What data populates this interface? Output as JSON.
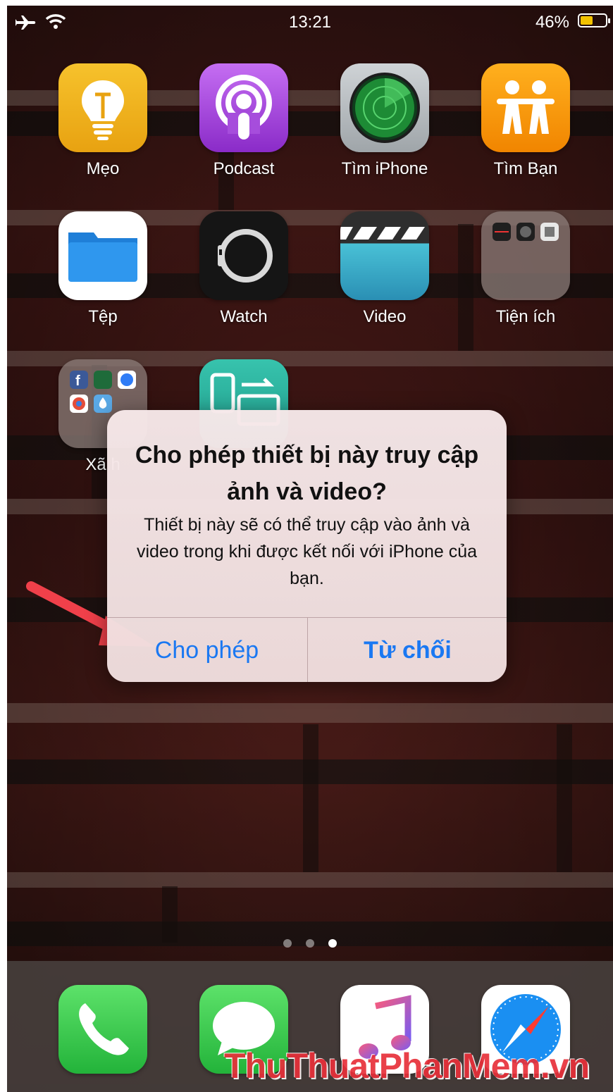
{
  "status_bar": {
    "time": "13:21",
    "battery_percent": "46%",
    "battery_level": 0.46,
    "battery_color": "#f2c200"
  },
  "home_screen": {
    "rows": [
      [
        {
          "label": "Mẹo",
          "icon": "lightbulb-icon"
        },
        {
          "label": "Podcast",
          "icon": "podcast-icon"
        },
        {
          "label": "Tìm iPhone",
          "icon": "find-iphone-radar-icon"
        },
        {
          "label": "Tìm Bạn",
          "icon": "find-friends-icon"
        }
      ],
      [
        {
          "label": "Tệp",
          "icon": "folder-icon"
        },
        {
          "label": "Watch",
          "icon": "watch-icon"
        },
        {
          "label": "Video",
          "icon": "clapperboard-icon"
        },
        {
          "label": "Tiện ích",
          "icon": "utilities-folder-icon"
        }
      ],
      [
        {
          "label": "Xã h",
          "icon": "social-folder-icon"
        },
        {
          "label": "",
          "icon": "device-transfer-icon"
        }
      ]
    ],
    "page_indicator": {
      "count": 3,
      "active_index": 2
    }
  },
  "dock": [
    {
      "icon": "phone-icon"
    },
    {
      "icon": "messages-icon"
    },
    {
      "icon": "music-icon"
    },
    {
      "icon": "safari-compass-icon"
    }
  ],
  "dialog": {
    "title": "Cho phép thiết bị này truy cập ảnh và video?",
    "message": "Thiết bị này sẽ có thể truy cập vào ảnh và video trong khi được kết nối với iPhone của bạn.",
    "allow_label": "Cho phép",
    "deny_label": "Từ chối",
    "button_color": "#1a78f2"
  },
  "annotation": {
    "arrow_color": "#f0404a",
    "arrow_icon": "red-arrow-pointer"
  },
  "watermark": "ThuThuatPhanMem.vn"
}
